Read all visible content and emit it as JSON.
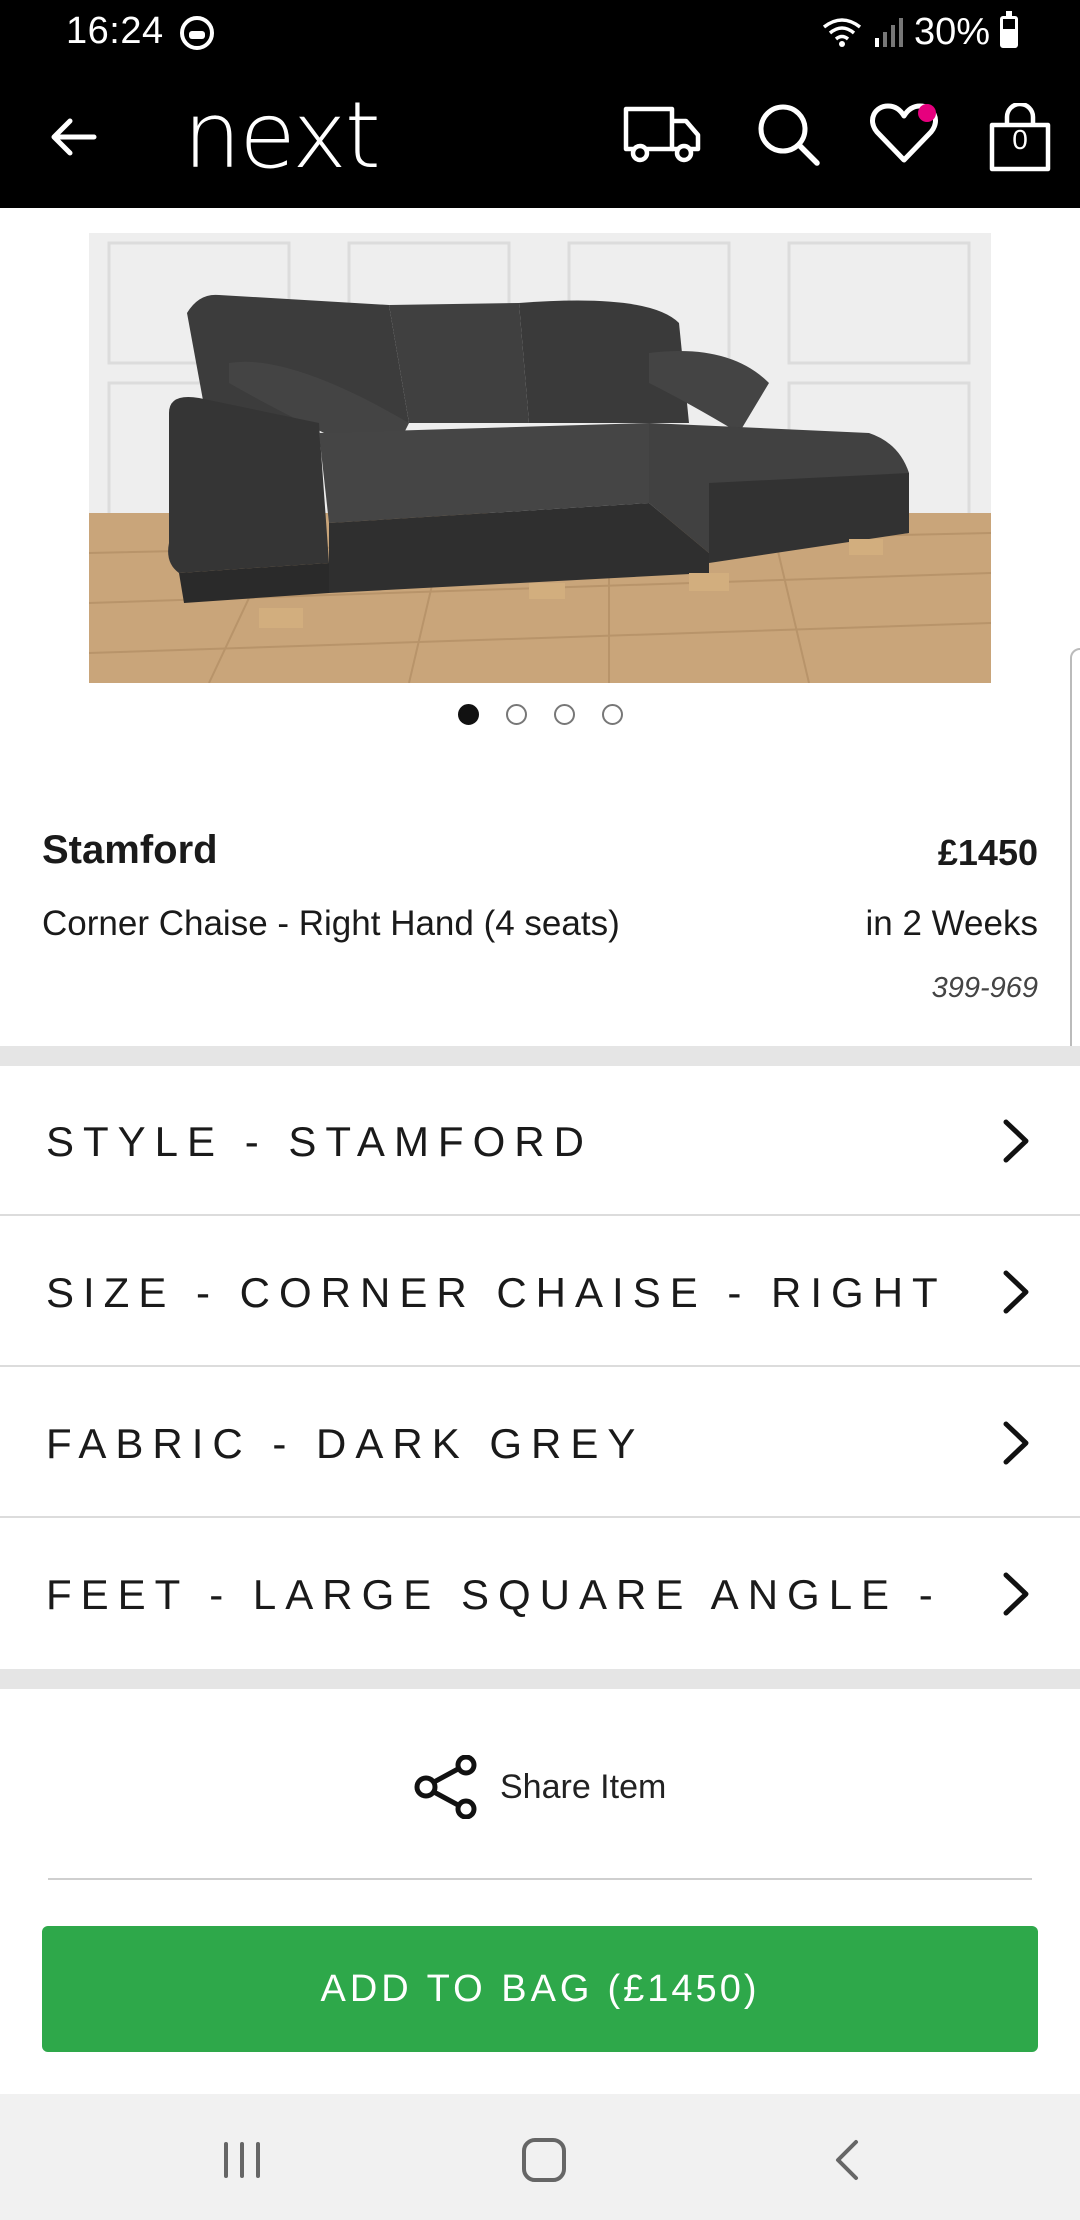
{
  "status_bar": {
    "time": "16:24",
    "battery": "30%"
  },
  "header": {
    "brand": "next",
    "bag_count": "0",
    "icons": [
      "back-arrow-icon",
      "delivery-truck-icon",
      "search-icon",
      "heart-icon",
      "bag-icon"
    ]
  },
  "carousel": {
    "total": 4,
    "active": 1
  },
  "product": {
    "name": "Stamford",
    "price": "£1450",
    "variant": "Corner Chaise - Right Hand (4 seats)",
    "delivery": "in 2 Weeks",
    "code": "399-969"
  },
  "options": [
    {
      "label": "STYLE - STAMFORD"
    },
    {
      "label": "SIZE - CORNER CHAISE - RIGHT ..."
    },
    {
      "label": "FABRIC - DARK GREY"
    },
    {
      "label": "FEET - LARGE SQUARE ANGLE - ..."
    }
  ],
  "share": {
    "label": "Share Item"
  },
  "add_to_bag": {
    "label": "ADD TO BAG",
    "price": "(£1450)"
  },
  "colors": {
    "header_bg": "#000000",
    "accent_green": "#2ea84a",
    "wishlist_dot": "#e6007e",
    "band_grey": "#e5e5e5"
  }
}
